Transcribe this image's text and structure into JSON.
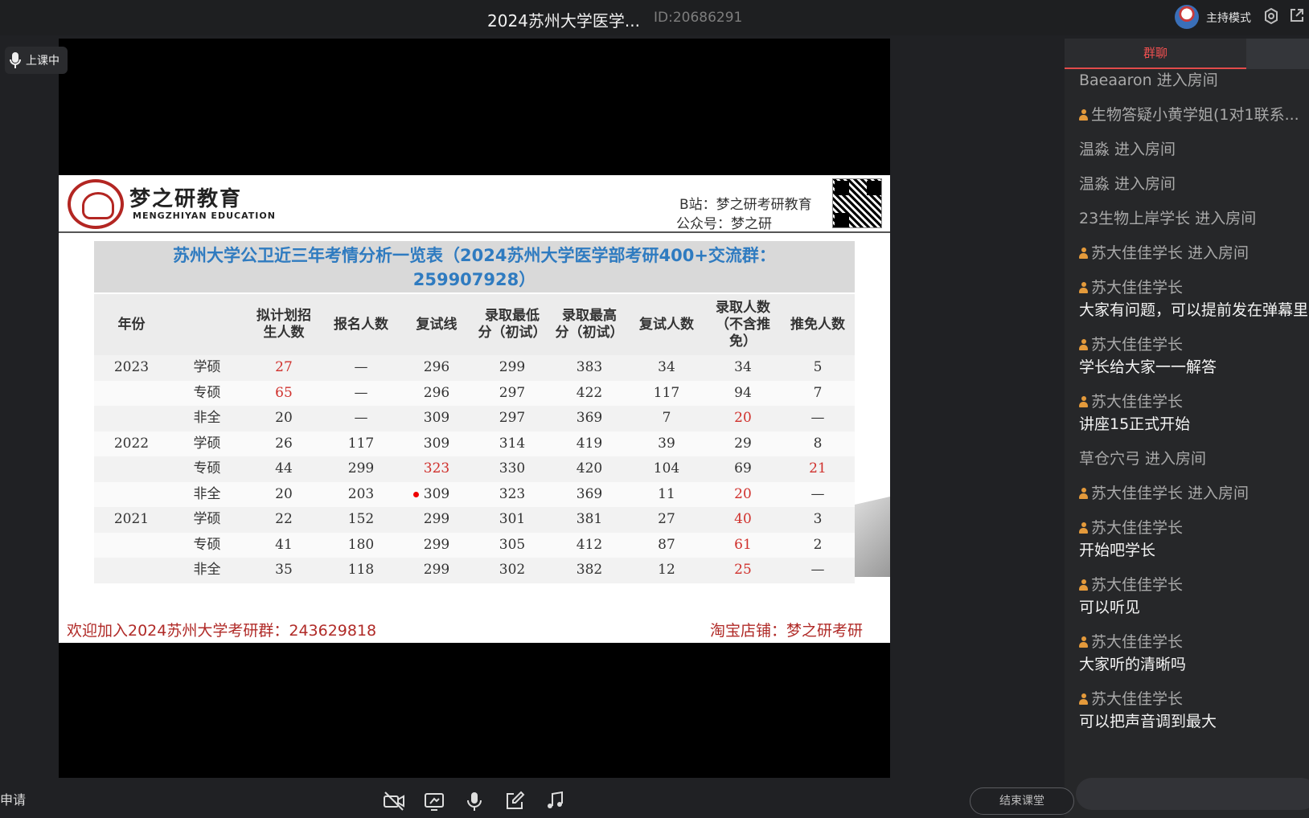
{
  "window": {
    "title": "2024苏州大学医学...",
    "room_id": "ID:20686291",
    "host_mode": "主持模式"
  },
  "status_badge": "上课中",
  "slide": {
    "brand_cn": "梦之研教育",
    "brand_en": "MENGZHIYAN EDUCATION",
    "bilibili": "B站：梦之研考研教育",
    "wechat": "公众号：梦之研",
    "table_title_line1": "苏州大学公卫近三年考情分析一览表（2024苏州大学医学部考研400+交流群：",
    "table_title_line2": "259907928）",
    "headers": [
      "年份",
      "",
      "拟计划招\n生人数",
      "报名人数",
      "复试线",
      "录取最低\n分（初试）",
      "录取最高\n分（初试）",
      "复试人数",
      "录取人数\n（不含推\n免）",
      "推免人数"
    ],
    "rows": [
      [
        "2023",
        "学硕",
        "27",
        "—",
        "296",
        "299",
        "383",
        "34",
        "34",
        "5"
      ],
      [
        "",
        "专硕",
        "65",
        "—",
        "296",
        "297",
        "422",
        "117",
        "94",
        "7"
      ],
      [
        "",
        "非全",
        "20",
        "—",
        "309",
        "297",
        "369",
        "7",
        "20",
        "—"
      ],
      [
        "2022",
        "学硕",
        "26",
        "117",
        "309",
        "314",
        "419",
        "39",
        "29",
        "8"
      ],
      [
        "",
        "专硕",
        "44",
        "299",
        "323",
        "330",
        "420",
        "104",
        "69",
        "21"
      ],
      [
        "",
        "非全",
        "20",
        "203",
        "309",
        "323",
        "369",
        "11",
        "20",
        "—"
      ],
      [
        "2021",
        "学硕",
        "22",
        "152",
        "299",
        "301",
        "381",
        "27",
        "40",
        "3"
      ],
      [
        "",
        "专硕",
        "41",
        "180",
        "299",
        "305",
        "412",
        "87",
        "61",
        "2"
      ],
      [
        "",
        "非全",
        "35",
        "118",
        "299",
        "302",
        "382",
        "12",
        "25",
        "—"
      ]
    ],
    "red_cells": [
      [
        0,
        2
      ],
      [
        1,
        2
      ],
      [
        2,
        8
      ],
      [
        4,
        4
      ],
      [
        4,
        9
      ],
      [
        5,
        8
      ],
      [
        6,
        8
      ],
      [
        7,
        8
      ],
      [
        8,
        8
      ]
    ],
    "footer_left": "欢迎加入2024苏州大学考研群：243629818",
    "footer_right": "淘宝店铺：梦之研考研"
  },
  "chat": {
    "tab_label": "群聊",
    "messages": [
      {
        "name": "Baeaaron 进入房间",
        "badge": false,
        "text": ""
      },
      {
        "name": "生物答疑小黄学姐(1对1联系...",
        "badge": true,
        "text": ""
      },
      {
        "name": "温淼 进入房间",
        "badge": false,
        "text": ""
      },
      {
        "name": "温淼 进入房间",
        "badge": false,
        "text": ""
      },
      {
        "name": "23生物上岸学长 进入房间",
        "badge": false,
        "text": ""
      },
      {
        "name": "苏大佳佳学长 进入房间",
        "badge": true,
        "text": ""
      },
      {
        "name": "苏大佳佳学长",
        "badge": true,
        "text": "大家有问题，可以提前发在弹幕里"
      },
      {
        "name": "苏大佳佳学长",
        "badge": true,
        "text": "学长给大家一一解答"
      },
      {
        "name": "苏大佳佳学长",
        "badge": true,
        "text": "讲座15正式开始"
      },
      {
        "name": "草仓穴弓 进入房间",
        "badge": false,
        "text": ""
      },
      {
        "name": "苏大佳佳学长 进入房间",
        "badge": true,
        "text": ""
      },
      {
        "name": "苏大佳佳学长",
        "badge": true,
        "text": "开始吧学长"
      },
      {
        "name": "苏大佳佳学长",
        "badge": true,
        "text": "可以听见"
      },
      {
        "name": "苏大佳佳学长",
        "badge": true,
        "text": "大家听的清晰吗"
      },
      {
        "name": "苏大佳佳学长",
        "badge": true,
        "text": "可以把声音调到最大"
      }
    ]
  },
  "bottom": {
    "apply_label": "申请",
    "end_class_label": "结束课堂",
    "controls": [
      "camera-off-icon",
      "screen-share-icon",
      "microphone-icon",
      "whiteboard-edit-icon",
      "music-icon"
    ]
  }
}
